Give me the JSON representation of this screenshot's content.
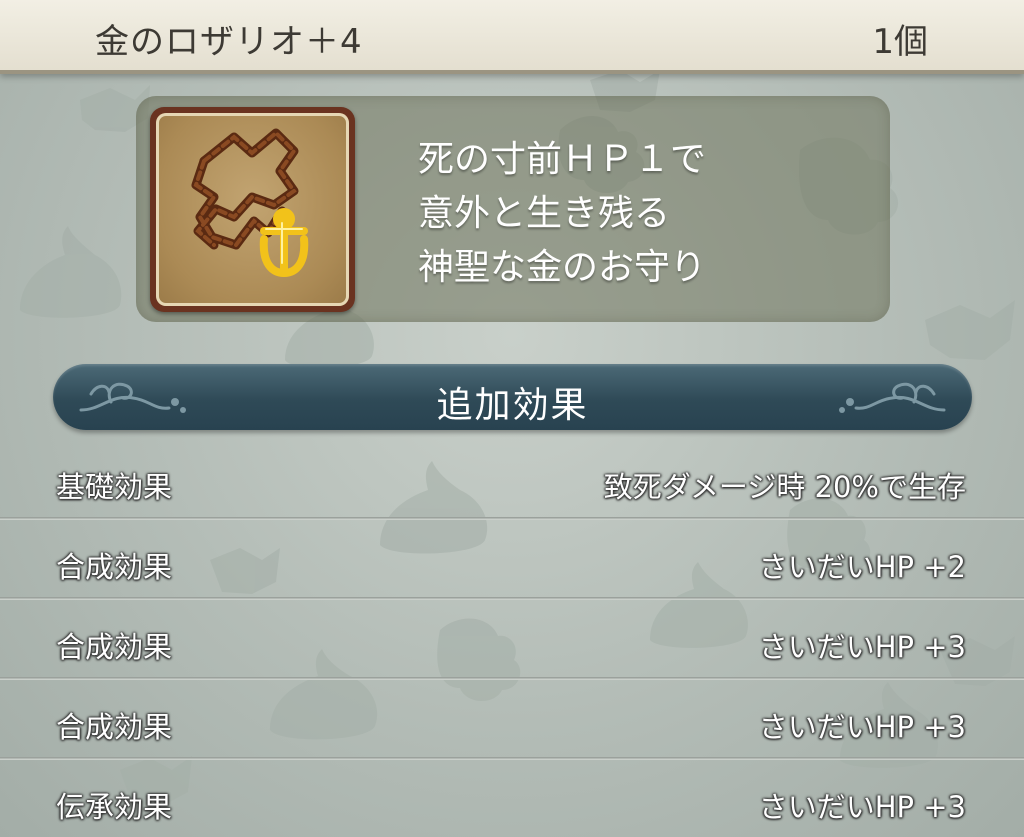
{
  "header": {
    "item_name": "金のロザリオ＋4",
    "count": "1個"
  },
  "item": {
    "icon": "gold-rosary-icon",
    "description_lines": [
      "死の寸前ＨＰ１で",
      "意外と生き残る",
      "神聖な金のお守り"
    ]
  },
  "section": {
    "title": "追加効果"
  },
  "effects": [
    {
      "label": "基礎効果",
      "value": "致死ダメージ時 20%で生存"
    },
    {
      "label": "合成効果",
      "value": "さいだいHP +2"
    },
    {
      "label": "合成効果",
      "value": "さいだいHP +3"
    },
    {
      "label": "合成効果",
      "value": "さいだいHP +3"
    },
    {
      "label": "伝承効果",
      "value": "さいだいHP +3"
    }
  ],
  "colors": {
    "section_bar": "#2f4a57",
    "panel": "#70745c",
    "background": "#b3bcb6",
    "header": "#ece8da"
  }
}
